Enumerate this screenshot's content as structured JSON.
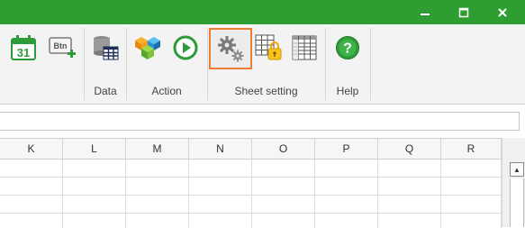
{
  "window": {
    "minimize_glyph": "—",
    "maximize_glyph": "☐",
    "close_glyph": "✕"
  },
  "ribbon": {
    "groups": [
      {
        "label": "Data"
      },
      {
        "label": "Action"
      },
      {
        "label": "Sheet setting"
      },
      {
        "label": "Help"
      }
    ],
    "buttons": [
      {
        "icon": "calendar-icon",
        "calendar_day": "31"
      },
      {
        "icon": "add-button-icon",
        "label_on_icon": "Btn"
      },
      {
        "icon": "database-table-icon"
      },
      {
        "icon": "cubes-icon"
      },
      {
        "icon": "play-icon"
      },
      {
        "icon": "settings-gears-icon",
        "selected": true
      },
      {
        "icon": "sheet-lock-icon"
      },
      {
        "icon": "sheet-grid-icon"
      },
      {
        "icon": "help-icon",
        "glyph": "?"
      }
    ],
    "accent_selected": "#ed7d31"
  },
  "formula_bar": {
    "value": "",
    "placeholder": ""
  },
  "grid": {
    "columns": [
      "K",
      "L",
      "M",
      "N",
      "O",
      "P",
      "Q",
      "R"
    ],
    "row_count": 4
  },
  "scrollbar": {
    "up_glyph": "▲"
  },
  "colors": {
    "title_bar": "#2f9e32",
    "ribbon_bg": "#f3f3f3",
    "header_bg": "#f6f6f6"
  }
}
